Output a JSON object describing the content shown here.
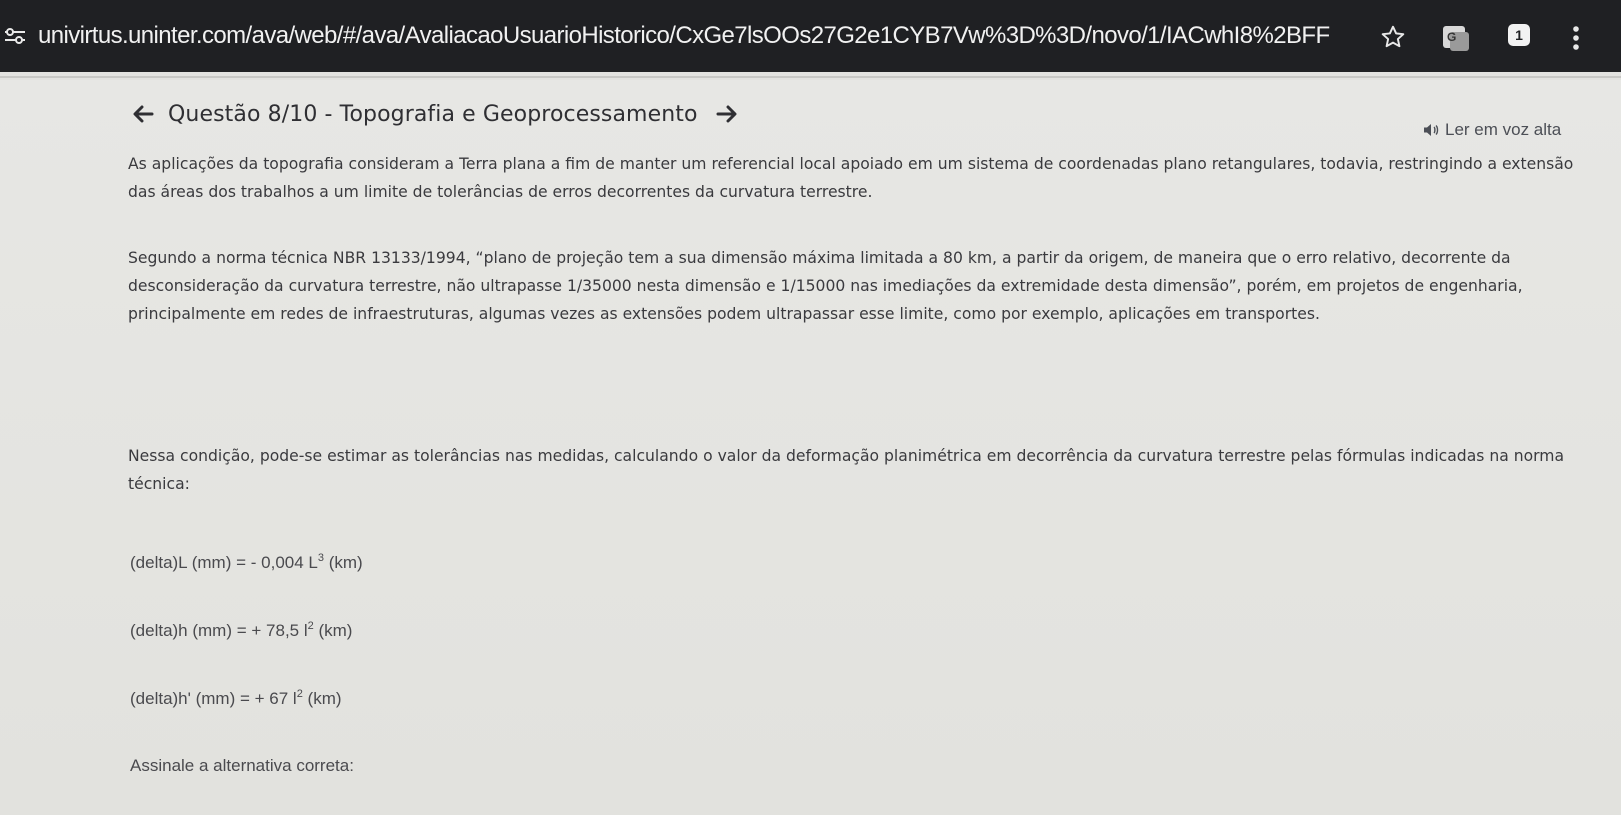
{
  "browser": {
    "url": "univirtus.uninter.com/ava/web/#/ava/AvaliacaoUsuarioHistorico/CxGe7lsOOs27G2e1CYB7Vw%3D%3D/novo/1/IACwhI8%2BFF",
    "star_icon": "star-icon",
    "translate_icon": "google-translate-icon",
    "extension_badge": "1",
    "menu_icon": "kebab-menu-icon"
  },
  "question": {
    "title": "Questão 8/10 - Topografia e Geoprocessamento",
    "read_aloud": "Ler em voz alta",
    "paragraphs": [
      "As aplicações da topografia consideram a Terra plana a fim de manter um referencial local apoiado em um sistema de coordenadas plano retangulares, todavia, restringindo a extensão das áreas dos trabalhos a um limite de tolerâncias de erros decorrentes da curvatura terrestre.",
      "Segundo a norma técnica NBR 13133/1994, “plano de projeção tem a sua dimensão máxima limitada a 80 km, a partir da origem, de maneira que o erro relativo, decorrente da desconsideração da curvatura terrestre, não ultrapasse 1/35000 nesta dimensão e 1/15000 nas imediações da extremidade desta dimensão”, porém, em projetos de engenharia, principalmente em redes de infraestruturas, algumas vezes as extensões podem ultrapassar esse limite, como por exemplo, aplicações em transportes.",
      "Nessa condição, pode-se estimar as tolerâncias nas medidas, calculando o valor da deformação planimétrica em decorrência da curvatura terrestre pelas fórmulas indicadas na norma técnica:"
    ],
    "formulas": [
      {
        "lhs": "(delta)L (mm) = - 0,004 L",
        "exp": "3",
        "unit": " (km)"
      },
      {
        "lhs": "(delta)h (mm) = + 78,5 l",
        "exp": "2",
        "unit": " (km)"
      },
      {
        "lhs": "(delta)h' (mm) = + 67 l",
        "exp": "2",
        "unit": " (km)"
      }
    ],
    "prompt": "Assinale a alternativa correta:"
  },
  "colors": {
    "browser_bar": "#1f2023",
    "page_bg": "#e2e2df",
    "text": "#3a3a3e",
    "title": "#2f2f33"
  }
}
